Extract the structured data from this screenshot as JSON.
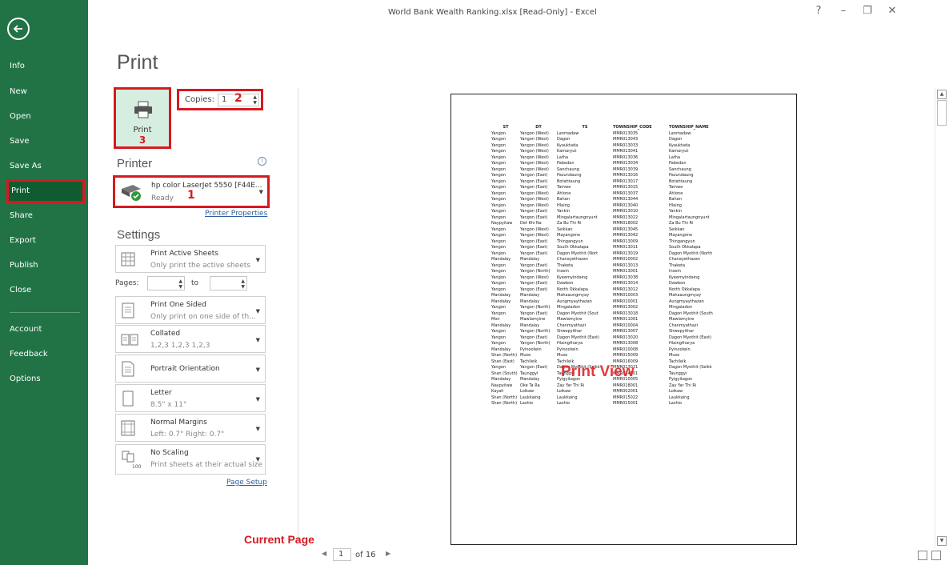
{
  "window": {
    "title": "World Bank Wealth Ranking.xlsx  [Read-Only]  -  Excel",
    "help": "?",
    "minimize": "–",
    "restore": "❐",
    "close": "✕"
  },
  "sidebar": {
    "items": [
      {
        "label": "Info"
      },
      {
        "label": "New"
      },
      {
        "label": "Open"
      },
      {
        "label": "Save"
      },
      {
        "label": "Save As"
      },
      {
        "label": "Print"
      },
      {
        "label": "Share"
      },
      {
        "label": "Export"
      },
      {
        "label": "Publish"
      },
      {
        "label": "Close"
      },
      {
        "label": "Account"
      },
      {
        "label": "Feedback"
      },
      {
        "label": "Options"
      }
    ]
  },
  "page": {
    "title": "Print"
  },
  "print_button": {
    "label": "Print",
    "annotation": "3"
  },
  "copies": {
    "label": "Copies:",
    "value": "1",
    "annotation": "2"
  },
  "printer": {
    "heading": "Printer",
    "info": "i",
    "name": "hp color LaserJet 5550 [F44E...",
    "status": "Ready",
    "annotation": "1",
    "properties_link": "Printer Properties"
  },
  "settings": {
    "heading": "Settings",
    "active_sheets": {
      "main": "Print Active Sheets",
      "sub": "Only print the active sheets"
    },
    "pages": {
      "label": "Pages:",
      "to": "to"
    },
    "sides": {
      "main": "Print One Sided",
      "sub": "Only print on one side of th..."
    },
    "collation": {
      "main": "Collated",
      "sub": "1,2,3   1,2,3   1,2,3"
    },
    "orientation": {
      "main": "Portrait Orientation"
    },
    "paper": {
      "main": "Letter",
      "sub": "8.5\" x 11\""
    },
    "margins": {
      "main": "Normal Margins",
      "sub": "Left: 0.7\"   Right: 0.7\""
    },
    "scaling": {
      "main": "No Scaling",
      "sub": "Print sheets at their actual size",
      "icon_text": "100"
    },
    "page_setup_link": "Page Setup"
  },
  "preview": {
    "watermark": "Print View",
    "headers": [
      "ST",
      "DT",
      "TS",
      "TOWNSHIP_CODE",
      "TOWNSHIP_NAME"
    ],
    "rows": [
      [
        "Yangon",
        "Yangon (West)",
        "Lanmadaw",
        "MMR013035",
        "Lanmadaw"
      ],
      [
        "Yangon",
        "Yangon (West)",
        "Dagon",
        "MMR013043",
        "Dagon"
      ],
      [
        "Yangon",
        "Yangon (West)",
        "Kyauktada",
        "MMR013033",
        "Kyauktada"
      ],
      [
        "Yangon",
        "Yangon (West)",
        "Kamaryut",
        "MMR013041",
        "Kamaryut"
      ],
      [
        "Yangon",
        "Yangon (West)",
        "Latha",
        "MMR013036",
        "Latha"
      ],
      [
        "Yangon",
        "Yangon (West)",
        "Pabedan",
        "MMR013034",
        "Pabedan"
      ],
      [
        "Yangon",
        "Yangon (West)",
        "Sanchaung",
        "MMR013039",
        "Sanchaung"
      ],
      [
        "Yangon",
        "Yangon (East)",
        "Pazundaung",
        "MMR013016",
        "Pazundaung"
      ],
      [
        "Yangon",
        "Yangon (East)",
        "Botahtaung",
        "MMR013017",
        "Botahtaung"
      ],
      [
        "Yangon",
        "Yangon (East)",
        "Tamwe",
        "MMR013015",
        "Tamwe"
      ],
      [
        "Yangon",
        "Yangon (West)",
        "Ahlone",
        "MMR013037",
        "Ahlone"
      ],
      [
        "Yangon",
        "Yangon (West)",
        "Bahan",
        "MMR013044",
        "Bahan"
      ],
      [
        "Yangon",
        "Yangon (West)",
        "Hlaing",
        "MMR013040",
        "Hlaing"
      ],
      [
        "Yangon",
        "Yangon (East)",
        "Yankin",
        "MMR013010",
        "Yankin"
      ],
      [
        "Yangon",
        "Yangon (East)",
        "Mingalartaungnyunt",
        "MMR013022",
        "Mingalartaungnyunt"
      ],
      [
        "Naypyitaw",
        "Det Khi Na",
        "Za Bu Thi Ri",
        "MMR018002",
        "Za Bu Thi Ri"
      ],
      [
        "Yangon",
        "Yangon (West)",
        "Seikkan",
        "MMR013045",
        "Seikkan"
      ],
      [
        "Yangon",
        "Yangon (West)",
        "Mayangone",
        "MMR013042",
        "Mayangone"
      ],
      [
        "Yangon",
        "Yangon (East)",
        "Thingangyun",
        "MMR013009",
        "Thingangyun"
      ],
      [
        "Yangon",
        "Yangon (East)",
        "South Okkalapa",
        "MMR013011",
        "South Okkalapa"
      ],
      [
        "Yangon",
        "Yangon (East)",
        "Dagon Myothit (Nort",
        "MMR013019",
        "Dagon Myothit (North"
      ],
      [
        "Mandalay",
        "Mandalay",
        "Chanayethazan",
        "MMR010002",
        "Chanayethazan"
      ],
      [
        "Yangon",
        "Yangon (East)",
        "Thaketa",
        "MMR013013",
        "Thaketa"
      ],
      [
        "Yangon",
        "Yangon (North)",
        "Insein",
        "MMR013001",
        "Insein"
      ],
      [
        "Yangon",
        "Yangon (West)",
        "Kyeemyindaing",
        "MMR013038",
        "Kyeemyindaing"
      ],
      [
        "Yangon",
        "Yangon (East)",
        "Dawbon",
        "MMR013014",
        "Dawbon"
      ],
      [
        "Yangon",
        "Yangon (East)",
        "North Okkalapa",
        "MMR013012",
        "North Okkalapa"
      ],
      [
        "Mandalay",
        "Mandalay",
        "Mahaaungmyay",
        "MMR010003",
        "Mahaaungmyay"
      ],
      [
        "Mandalay",
        "Mandalay",
        "Aungmyaythazan",
        "MMR010001",
        "Aungmyaythazan"
      ],
      [
        "Yangon",
        "Yangon (North)",
        "Mingaladon",
        "MMR013002",
        "Mingaladon"
      ],
      [
        "Yangon",
        "Yangon (East)",
        "Dagon Myothit (Sout",
        "MMR013018",
        "Dagon Myothit (South"
      ],
      [
        "Mon",
        "Mawlamyine",
        "Mawlamyine",
        "MMR011001",
        "Mawlamyine"
      ],
      [
        "Mandalay",
        "Mandalay",
        "Chanmyathazi",
        "MMR010004",
        "Chanmyathazi"
      ],
      [
        "Yangon",
        "Yangon (North)",
        "Shwepyithar",
        "MMR013007",
        "Shwepyithar"
      ],
      [
        "Yangon",
        "Yangon (East)",
        "Dagon Myothit (East)",
        "MMR013020",
        "Dagon Myothit (East)"
      ],
      [
        "Yangon",
        "Yangon (North)",
        "Hlaingtharya",
        "MMR013008",
        "Hlaingtharya"
      ],
      [
        "Mandalay",
        "Pyinoolwin",
        "Pyinoolwin",
        "MMR010008",
        "Pyinoolwin"
      ],
      [
        "Shan (North)",
        "Muse",
        "Muse",
        "MMR015009",
        "Muse"
      ],
      [
        "Shan (East)",
        "Tachileik",
        "Tachileik",
        "MMR016009",
        "Tachileik"
      ],
      [
        "Yangon",
        "Yangon (East)",
        "Dagon Myothit (Seikk",
        "MMR013021",
        "Dagon Myothit (Seikk"
      ],
      [
        "Shan (South)",
        "Taunggyi",
        "Taunggyi",
        "MMR014001",
        "Taunggyi"
      ],
      [
        "Mandalay",
        "Mandalay",
        "Pyigyitagon",
        "MMR010005",
        "Pyigyitagon"
      ],
      [
        "Naypyitaw",
        "Oke Ta Ra",
        "Zay Yar Thi Ri",
        "MMR018001",
        "Zay Yar Thi Ri"
      ],
      [
        "Kayah",
        "Loikaw",
        "Loikaw",
        "MMR002001",
        "Loikaw"
      ],
      [
        "Shan (North)",
        "Laukkaing",
        "Laukkaing",
        "MMR015022",
        "Laukkaing"
      ],
      [
        "Shan (North)",
        "Lashio",
        "Lashio",
        "MMR015001",
        "Lashio"
      ]
    ]
  },
  "pagination": {
    "label": "Current Page",
    "current": "1",
    "total_text": "of 16",
    "prev": "◀",
    "next": "▶"
  },
  "colors": {
    "sidebar": "#217346",
    "annotation_red": "#d71920",
    "print_button_bg": "#d6eedf"
  }
}
